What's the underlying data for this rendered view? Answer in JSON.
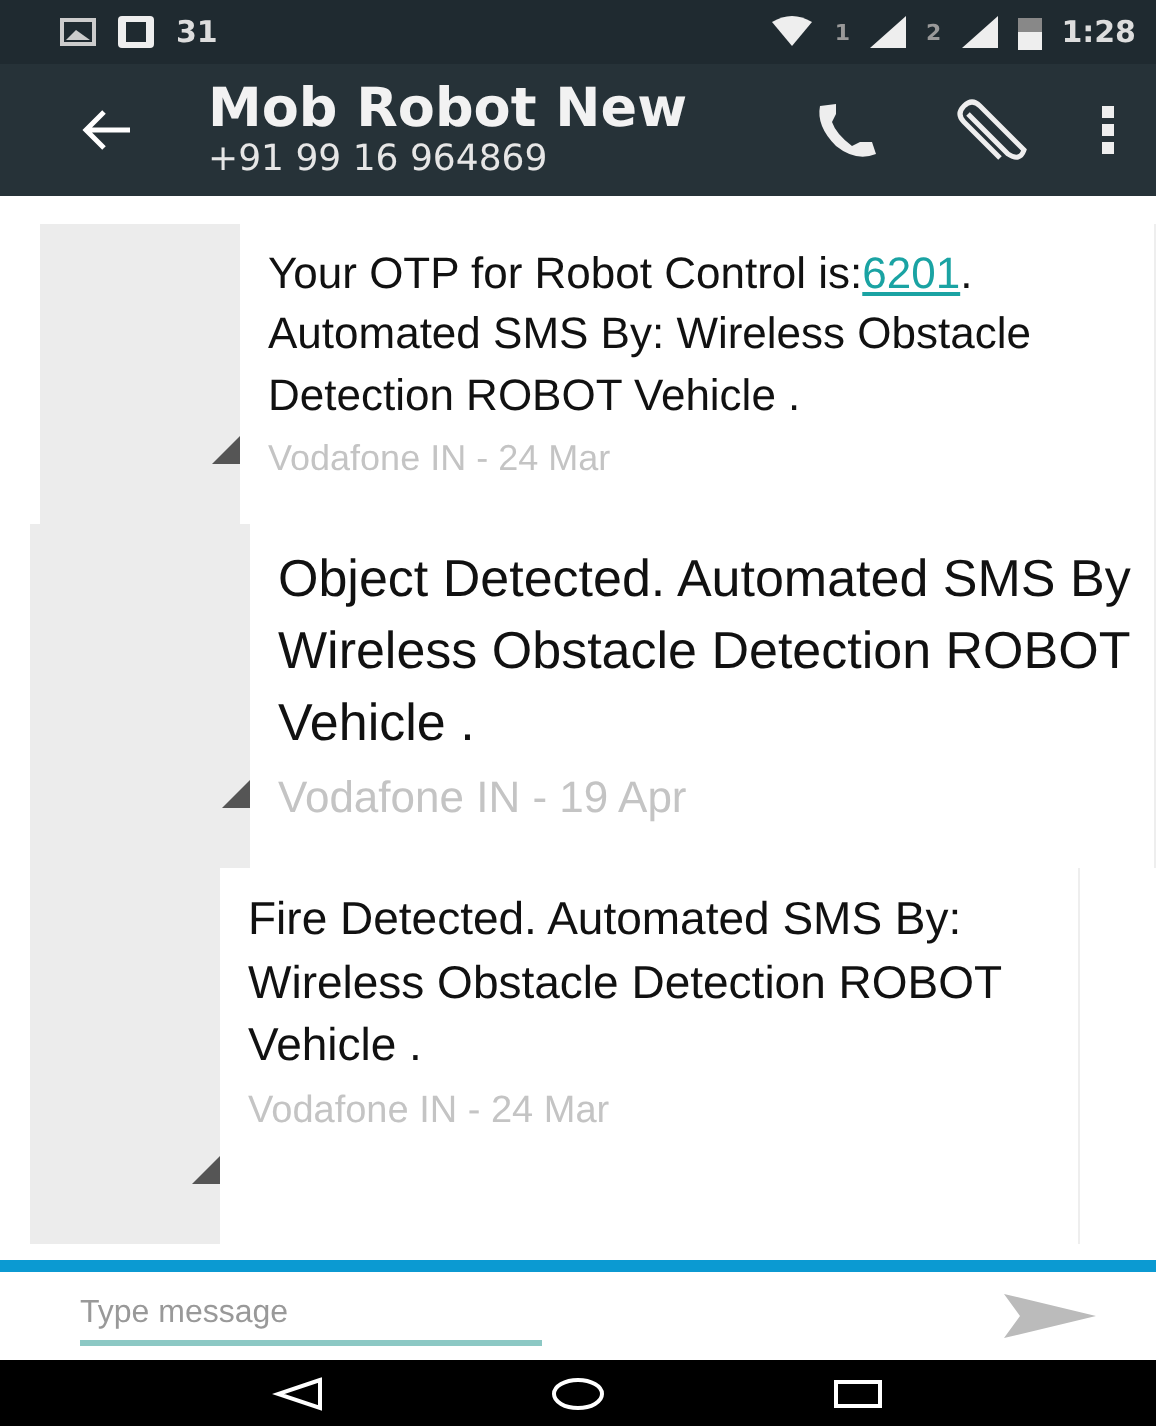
{
  "status_bar": {
    "notification_count": "31",
    "time": "1:28",
    "sim_labels": [
      "1",
      "2"
    ]
  },
  "header": {
    "title": "Mob Robot New",
    "subtitle": "+91 99 16 964869"
  },
  "messages": [
    {
      "segments": [
        {
          "kind": "text",
          "text": "Your OTP for Robot Control is:"
        },
        {
          "kind": "link",
          "text": "6201"
        },
        {
          "kind": "text",
          "text": ". Automated SMS By: Wireless Obstacle Detection ROBOT Vehicle ."
        }
      ],
      "meta": "Vodafone IN - 24 Mar"
    },
    {
      "segments": [
        {
          "kind": "text",
          "text": "Object Detected. Automated SMS By Wireless Obstacle Detection ROBOT Vehicle ."
        }
      ],
      "meta": "Vodafone IN - 19 Apr"
    },
    {
      "segments": [
        {
          "kind": "text",
          "text": "Fire Detected. Automated SMS By: Wireless Obstacle Detection ROBOT Vehicle ."
        }
      ],
      "meta": "Vodafone IN - 24 Mar"
    }
  ],
  "composer": {
    "placeholder": "Type message"
  }
}
